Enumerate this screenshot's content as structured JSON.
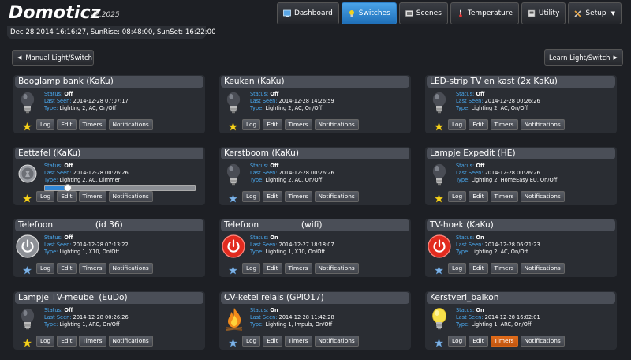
{
  "app": {
    "logo": "Domoticz",
    "version": "V2.2025"
  },
  "nav": [
    {
      "label": "Dashboard",
      "icon": "dashboard-icon",
      "active": false
    },
    {
      "label": "Switches",
      "icon": "lightbulb-icon",
      "active": true
    },
    {
      "label": "Scenes",
      "icon": "scenes-icon",
      "active": false
    },
    {
      "label": "Temperature",
      "icon": "thermometer-icon",
      "active": false
    },
    {
      "label": "Utility",
      "icon": "utility-icon",
      "active": false
    },
    {
      "label": "Setup",
      "icon": "tools-icon",
      "active": false
    }
  ],
  "timebar": "Dec 28 2014 16:16:27, SunRise: 08:48:00, SunSet: 16:22:00",
  "actions": {
    "manual_label": "Manual Light/Switch",
    "learn_label": "Learn Light/Switch"
  },
  "labels": {
    "status": "Status:",
    "last_seen": "Last Seen:",
    "type": "Type:"
  },
  "buttons": {
    "log": "Log",
    "edit": "Edit",
    "timers": "Timers",
    "notifications": "Notifications"
  },
  "colors": {
    "accent": "#49a9f0",
    "active_nav": "#2d7fc7",
    "timers_active": "#e06c1a",
    "star_favorite": "#f5d21c",
    "star_normal": "#7fb3e6",
    "power_on": "#e22b1f"
  },
  "devices": [
    {
      "name": "Booglamp bank (KaKu)",
      "status": "Off",
      "last_seen": "2014-12-28 07:07:17",
      "type": "Lighting 2, AC, On/Off",
      "icon": "lightbulb-off-icon",
      "favorite": true,
      "timers_active": false
    },
    {
      "name": "Keuken (KaKu)",
      "status": "Off",
      "last_seen": "2014-12-28 14:26:59",
      "type": "Lighting 2, AC, On/Off",
      "icon": "lightbulb-off-icon",
      "favorite": true,
      "timers_active": false
    },
    {
      "name": "LED-strip TV en kast (2x KaKu)",
      "status": "Off",
      "last_seen": "2014-12-28 00:26:26",
      "type": "Lighting 2, AC, On/Off",
      "icon": "lightbulb-off-icon",
      "favorite": true,
      "timers_active": false
    },
    {
      "name": "Eettafel (KaKu)",
      "status": "Off",
      "last_seen": "2014-12-28 00:26:26",
      "type": "Lighting 2, AC, Dimmer",
      "icon": "dimmer-icon",
      "favorite": true,
      "timers_active": false,
      "dimmer_level": 0.15
    },
    {
      "name": "Kerstboom (KaKu)",
      "status": "Off",
      "last_seen": "2014-12-28 00:26:26",
      "type": "Lighting 2, AC, On/Off",
      "icon": "lightbulb-off-icon",
      "favorite": false,
      "timers_active": false
    },
    {
      "name": "Lampje Expedit (HE)",
      "status": "Off",
      "last_seen": "2014-12-28 00:26:26",
      "type": "Lighting 2, HomeEasy EU, On/Off",
      "icon": "lightbulb-off-icon",
      "favorite": true,
      "timers_active": false
    },
    {
      "name": "Telefoon                (id 36)",
      "status": "Off",
      "last_seen": "2014-12-28 07:13:22",
      "type": "Lighting 1, X10, On/Off",
      "icon": "power-off-icon",
      "favorite": false,
      "timers_active": false
    },
    {
      "name": "Telefoon                (wifi)",
      "status": "On",
      "last_seen": "2014-12-27 18:18:07",
      "type": "Lighting 1, X10, On/Off",
      "icon": "power-on-icon",
      "favorite": false,
      "timers_active": false
    },
    {
      "name": "TV-hoek (KaKu)",
      "status": "On",
      "last_seen": "2014-12-28 06:21:23",
      "type": "Lighting 2, AC, On/Off",
      "icon": "power-on-icon",
      "favorite": false,
      "timers_active": false
    },
    {
      "name": "Lampje TV-meubel (EuDo)",
      "status": "Off",
      "last_seen": "2014-12-28 00:26:26",
      "type": "Lighting 1, ARC, On/Off",
      "icon": "lightbulb-off-icon",
      "favorite": true,
      "timers_active": false
    },
    {
      "name": "CV-ketel relais (GPIO17)",
      "status": "On",
      "last_seen": "2014-12-28 11:42:28",
      "type": "Lighting 1, Impuls, On/Off",
      "icon": "fire-icon",
      "favorite": false,
      "timers_active": false
    },
    {
      "name": "Kerstverl_balkon",
      "status": "On",
      "last_seen": "2014-12-28 16:02:01",
      "type": "Lighting 1, ARC, On/Off",
      "icon": "lightbulb-on-icon",
      "favorite": false,
      "timers_active": true
    }
  ]
}
